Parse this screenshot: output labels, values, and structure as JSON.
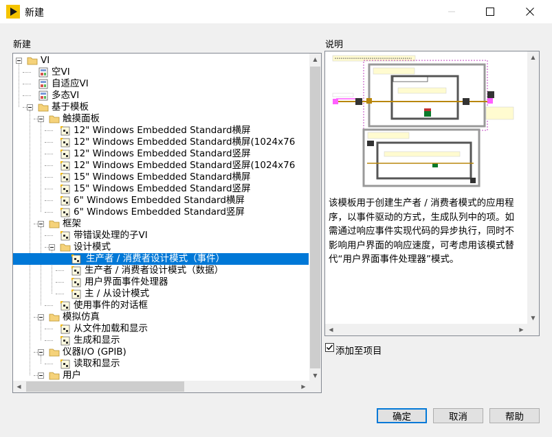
{
  "window": {
    "title": "新建"
  },
  "tree_section_label": "新建",
  "desc_section_label": "说明",
  "tree": [
    {
      "label": "VI",
      "level": 0,
      "type": "folder",
      "expanded": true
    },
    {
      "label": "空VI",
      "level": 1,
      "type": "vi"
    },
    {
      "label": "自适应VI",
      "level": 1,
      "type": "vi"
    },
    {
      "label": "多态VI",
      "level": 1,
      "type": "vi"
    },
    {
      "label": "基于模板",
      "level": 1,
      "type": "folder",
      "expanded": true
    },
    {
      "label": "触摸面板",
      "level": 2,
      "type": "folder",
      "expanded": true
    },
    {
      "label": "12\" Windows Embedded Standard横屏",
      "level": 3,
      "type": "template"
    },
    {
      "label": "12\" Windows Embedded Standard横屏(1024x76",
      "level": 3,
      "type": "template"
    },
    {
      "label": "12\" Windows Embedded Standard竖屏",
      "level": 3,
      "type": "template"
    },
    {
      "label": "12\" Windows Embedded Standard竖屏(1024x76",
      "level": 3,
      "type": "template"
    },
    {
      "label": "15\" Windows Embedded Standard横屏",
      "level": 3,
      "type": "template"
    },
    {
      "label": "15\" Windows Embedded Standard竖屏",
      "level": 3,
      "type": "template"
    },
    {
      "label": "6\" Windows Embedded Standard横屏",
      "level": 3,
      "type": "template"
    },
    {
      "label": "6\" Windows Embedded Standard竖屏",
      "level": 3,
      "type": "template"
    },
    {
      "label": "框架",
      "level": 2,
      "type": "folder",
      "expanded": true
    },
    {
      "label": "带错误处理的子VI",
      "level": 3,
      "type": "template"
    },
    {
      "label": "设计模式",
      "level": 3,
      "type": "folder",
      "expanded": true
    },
    {
      "label": "生产者 / 消费者设计模式（事件）",
      "level": 4,
      "type": "template",
      "selected": true
    },
    {
      "label": "生产者 / 消费者设计模式（数据）",
      "level": 4,
      "type": "template"
    },
    {
      "label": "用户界面事件处理器",
      "level": 4,
      "type": "template"
    },
    {
      "label": "主 / 从设计模式",
      "level": 4,
      "type": "template"
    },
    {
      "label": "使用事件的对话框",
      "level": 3,
      "type": "template"
    },
    {
      "label": "模拟仿真",
      "level": 2,
      "type": "folder",
      "expanded": true
    },
    {
      "label": "从文件加载和显示",
      "level": 3,
      "type": "template"
    },
    {
      "label": "生成和显示",
      "level": 3,
      "type": "template"
    },
    {
      "label": "仪器I/O (GPIB)",
      "level": 2,
      "type": "folder",
      "expanded": true
    },
    {
      "label": "读取和显示",
      "level": 3,
      "type": "template"
    },
    {
      "label": "用户",
      "level": 2,
      "type": "folder",
      "expanded": true
    }
  ],
  "description": "该模板用于创建生产者 / 消费者模式的应用程序，以事件驱动的方式，生成队列中的项。如需通过响应事件实现代码的异步执行，同时不影响用户界面的响应速度，可考虑用该模式替代“用户界面事件处理器”模式。",
  "checkbox": {
    "label": "添加至项目",
    "checked": true
  },
  "buttons": {
    "ok": "确定",
    "cancel": "取消",
    "help": "帮助"
  },
  "colors": {
    "selection": "#0078d7",
    "folder": "#f5d27a",
    "app_icon": "#f5c400"
  },
  "icons": {
    "minimize": "minimize-icon",
    "maximize": "maximize-icon",
    "close": "close-icon"
  }
}
